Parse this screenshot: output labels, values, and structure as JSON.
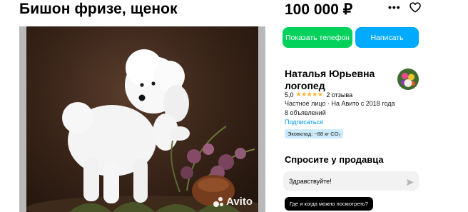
{
  "listing": {
    "title": "Бишон фризе, щенок",
    "price": "100 000 ₽"
  },
  "icons": {
    "more": "more-dots-icon",
    "favorite": "heart-icon",
    "send": "send-arrow-icon"
  },
  "photo": {
    "watermark": "Avito"
  },
  "actions": {
    "show_phone": "Показать телефон",
    "write": "Написать"
  },
  "seller": {
    "name": "Наталья Юрьевна логопед",
    "rating": "5,0",
    "stars": "★★★★★",
    "reviews": "2 отзыва",
    "type_since": "Частное лицо · На Авито с 2018 года",
    "listings_count": "8 объявлений",
    "subscribe": "Подписаться",
    "eco_badge": "Эковклад: ~88 кг CO₂"
  },
  "ask": {
    "title": "Спросите у продавца",
    "message_value": "Здравствуйте!",
    "quick_question": "Где и когда можно посмотреть?"
  },
  "colors": {
    "phone_button": "#02d15c",
    "write_button": "#00aaff",
    "link": "#0099f7",
    "stars": "#ffb021",
    "eco_badge_bg": "#cdebfa"
  }
}
